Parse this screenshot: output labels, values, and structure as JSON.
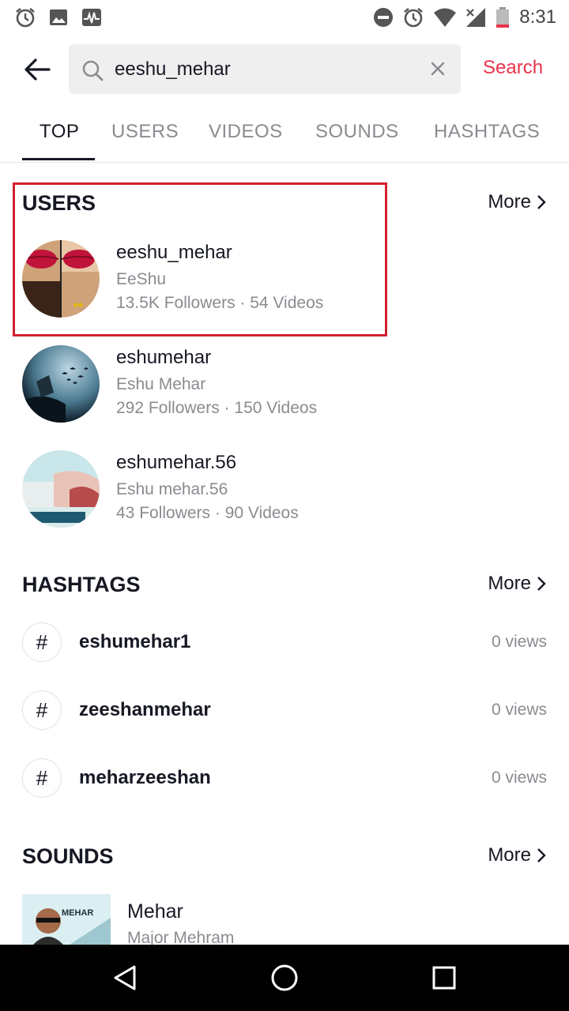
{
  "status_bar": {
    "time": "8:31",
    "left_icons": [
      "alarm-icon",
      "image-icon",
      "pulse-icon"
    ],
    "right_icons": [
      "do-not-disturb-icon",
      "alarm-icon",
      "wifi-icon",
      "signal-icon",
      "battery-icon"
    ]
  },
  "search": {
    "query": "eeshu_mehar",
    "action_label": "Search",
    "accent_color": "#e8344b"
  },
  "tabs": [
    {
      "label": "TOP",
      "active": true
    },
    {
      "label": "USERS",
      "active": false
    },
    {
      "label": "VIDEOS",
      "active": false
    },
    {
      "label": "SOUNDS",
      "active": false
    },
    {
      "label": "HASHTAGS",
      "active": false
    }
  ],
  "users_section": {
    "title": "USERS",
    "more_label": "More",
    "items": [
      {
        "handle": "eeshu_mehar",
        "name": "EeShu",
        "stats": "13.5K Followers · 54 Videos",
        "highlighted": true
      },
      {
        "handle": "eshumehar",
        "name": "Eshu Mehar",
        "stats": "292 Followers · 150 Videos"
      },
      {
        "handle": "eshumehar.56",
        "name": "Eshu mehar.56",
        "stats": "43 Followers · 90 Videos"
      }
    ]
  },
  "hashtags_section": {
    "title": "HASHTAGS",
    "more_label": "More",
    "items": [
      {
        "name": "eshumehar1",
        "views": "0 views"
      },
      {
        "name": "zeeshanmehar",
        "views": "0 views"
      },
      {
        "name": "meharzeeshan",
        "views": "0 views"
      }
    ]
  },
  "sounds_section": {
    "title": "SOUNDS",
    "more_label": "More",
    "items": [
      {
        "title": "Mehar",
        "author": "Major Mehram",
        "cover_text": "MEHAR"
      }
    ]
  },
  "highlight_color": "#d1202e"
}
